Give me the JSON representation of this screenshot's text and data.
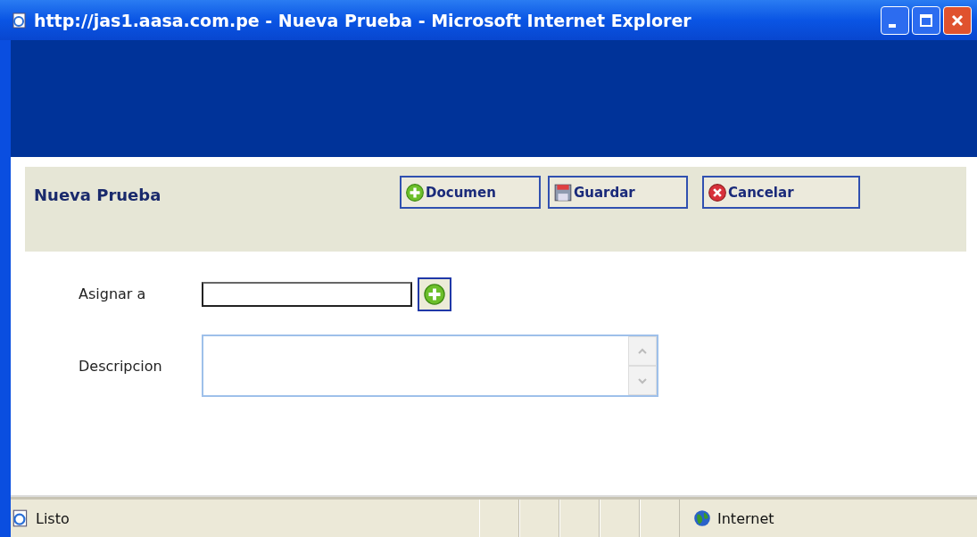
{
  "window": {
    "title": "http://jas1.aasa.com.pe - Nueva Prueba - Microsoft Internet Explorer"
  },
  "panel": {
    "title": "Nueva Prueba",
    "buttons": [
      {
        "label": "Documen",
        "kind": "add"
      },
      {
        "label": "Guardar",
        "kind": "save"
      },
      {
        "label": "Cancelar",
        "kind": "cancel"
      }
    ]
  },
  "form": [
    {
      "label": "Asignar a",
      "kind": "text"
    },
    {
      "label": "Descripcion",
      "kind": "textarea"
    }
  ],
  "status_bar": {
    "status": "Listo",
    "zone": "Internet"
  }
}
